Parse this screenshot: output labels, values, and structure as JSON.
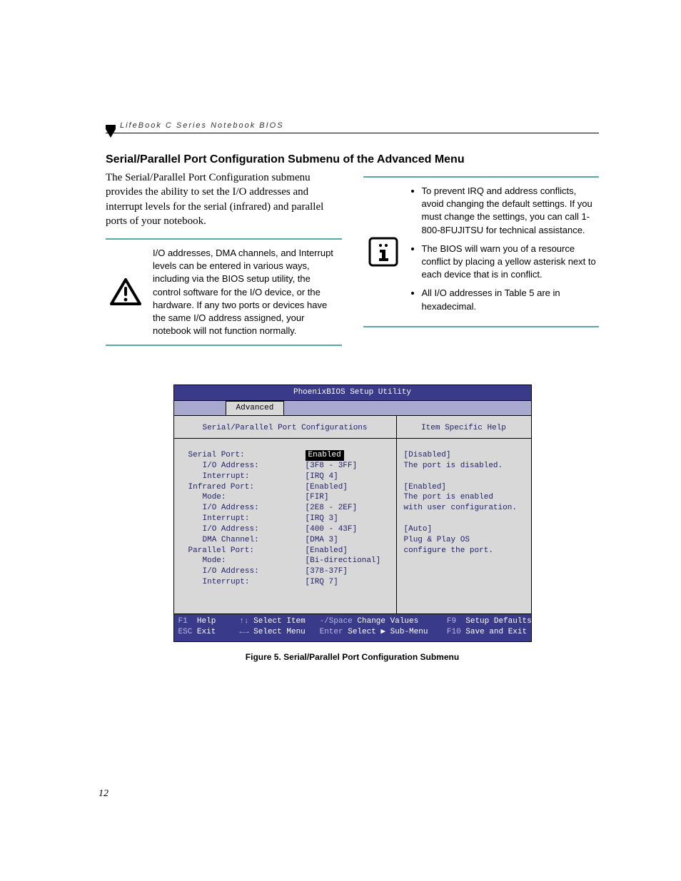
{
  "runhead": "LifeBook C Series Notebook BIOS",
  "heading": "Serial/Parallel Port Configuration Submenu of the Advanced Menu",
  "intro": "The Serial/Parallel Port Configuration submenu provides the ability to set the I/O addresses and interrupt levels for the serial (infrared) and parallel ports of your notebook.",
  "warn_callout": "I/O addresses, DMA channels, and Interrupt levels can be entered in various ways, including via the BIOS setup utility, the control software for the I/O device, or the hardware. If any two ports or devices have the same I/O address assigned, your notebook will not function normally.",
  "info_callout": {
    "items": [
      "To prevent IRQ and address conflicts, avoid changing the default settings. If you must change the settings, you can call 1-800-8FUJITSU for technical assistance.",
      "The BIOS will warn you of a resource conflict by placing a yellow asterisk next to each device that is in conflict.",
      "All I/O addresses in Table 5 are in hexadecimal."
    ]
  },
  "bios": {
    "title": "PhoenixBIOS Setup Utility",
    "tab": "Advanced",
    "left_title": "Serial/Parallel Port Configurations",
    "right_title": "Item Specific Help",
    "rows": [
      {
        "label": "Serial Port:",
        "indent": false,
        "value": "Enabled",
        "selected": true
      },
      {
        "label": "I/O Address:",
        "indent": true,
        "value": "[3F8 - 3FF]",
        "selected": false
      },
      {
        "label": "Interrupt:",
        "indent": true,
        "value": "[IRQ 4]",
        "selected": false
      },
      {
        "label": "Infrared Port:",
        "indent": false,
        "value": "[Enabled]",
        "selected": false
      },
      {
        "label": "Mode:",
        "indent": true,
        "value": "[FIR]",
        "selected": false
      },
      {
        "label": "I/O Address:",
        "indent": true,
        "value": "[2E8 - 2EF]",
        "selected": false
      },
      {
        "label": "Interrupt:",
        "indent": true,
        "value": "[IRQ 3]",
        "selected": false
      },
      {
        "label": "I/O Address:",
        "indent": true,
        "value": "[400 - 43F]",
        "selected": false
      },
      {
        "label": "DMA Channel:",
        "indent": true,
        "value": "[DMA 3]",
        "selected": false
      },
      {
        "label": "Parallel Port:",
        "indent": false,
        "value": "[Enabled]",
        "selected": false
      },
      {
        "label": "Mode:",
        "indent": true,
        "value": "[Bi-directional]",
        "selected": false
      },
      {
        "label": "I/O Address:",
        "indent": true,
        "value": "[378-37F]",
        "selected": false
      },
      {
        "label": "Interrupt:",
        "indent": true,
        "value": "[IRQ 7]",
        "selected": false
      }
    ],
    "help_text": "[Disabled]\nThe port is disabled.\n\n[Enabled]\nThe port is enabled\nwith user configuration.\n\n[Auto]\nPlug & Play OS\nconfigure the port.",
    "footer": {
      "l1_f1": "F1",
      "l1_help": "Help",
      "l1_arrows": "↑↓",
      "l1_sel": "Select Item",
      "l1_ms": "-/Space",
      "l1_cv": "Change Values",
      "l1_f9": "F9",
      "l1_sd": "Setup Defaults",
      "l2_esc": "ESC",
      "l2_exit": "Exit",
      "l2_arrows": "←→",
      "l2_sm": "Select Menu",
      "l2_enter": "Enter",
      "l2_sub": "Select ▶ Sub-Menu",
      "l2_f10": "F10",
      "l2_save": "Save and Exit"
    }
  },
  "figcap": "Figure 5.  Serial/Parallel Port Configuration Submenu",
  "pagenum": "12"
}
